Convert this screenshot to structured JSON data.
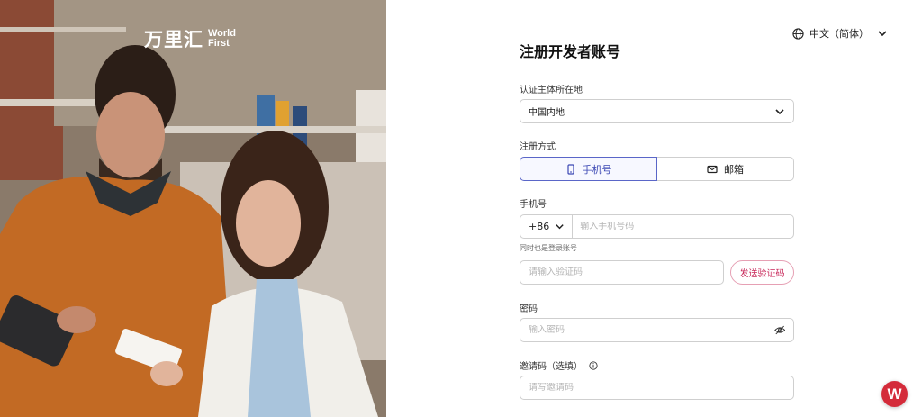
{
  "brand": {
    "cn": "万里汇",
    "en_line1": "World",
    "en_line2": "First"
  },
  "language": {
    "label": "中文（简体）",
    "icon": "globe-icon"
  },
  "form": {
    "title": "注册开发者账号",
    "region": {
      "label": "认证主体所在地",
      "value": "中国内地"
    },
    "method": {
      "label": "注册方式",
      "options": [
        {
          "label": "手机号",
          "icon": "phone-icon",
          "selected": true
        },
        {
          "label": "邮箱",
          "icon": "mail-icon",
          "selected": false
        }
      ]
    },
    "phone": {
      "label": "手机号",
      "country_code": "+86",
      "placeholder": "输入手机号码",
      "hint": "同时也是登录账号"
    },
    "code": {
      "placeholder": "请输入验证码",
      "send_label": "发送验证码"
    },
    "password": {
      "label": "密码",
      "placeholder": "输入密码"
    },
    "invite": {
      "label": "邀请码（选填）",
      "placeholder": "请写邀请码"
    }
  },
  "fab": {
    "label": "W"
  },
  "colors": {
    "accent": "#3b47b3",
    "brand_red": "#d42b3a",
    "send_text": "#c8285a"
  }
}
